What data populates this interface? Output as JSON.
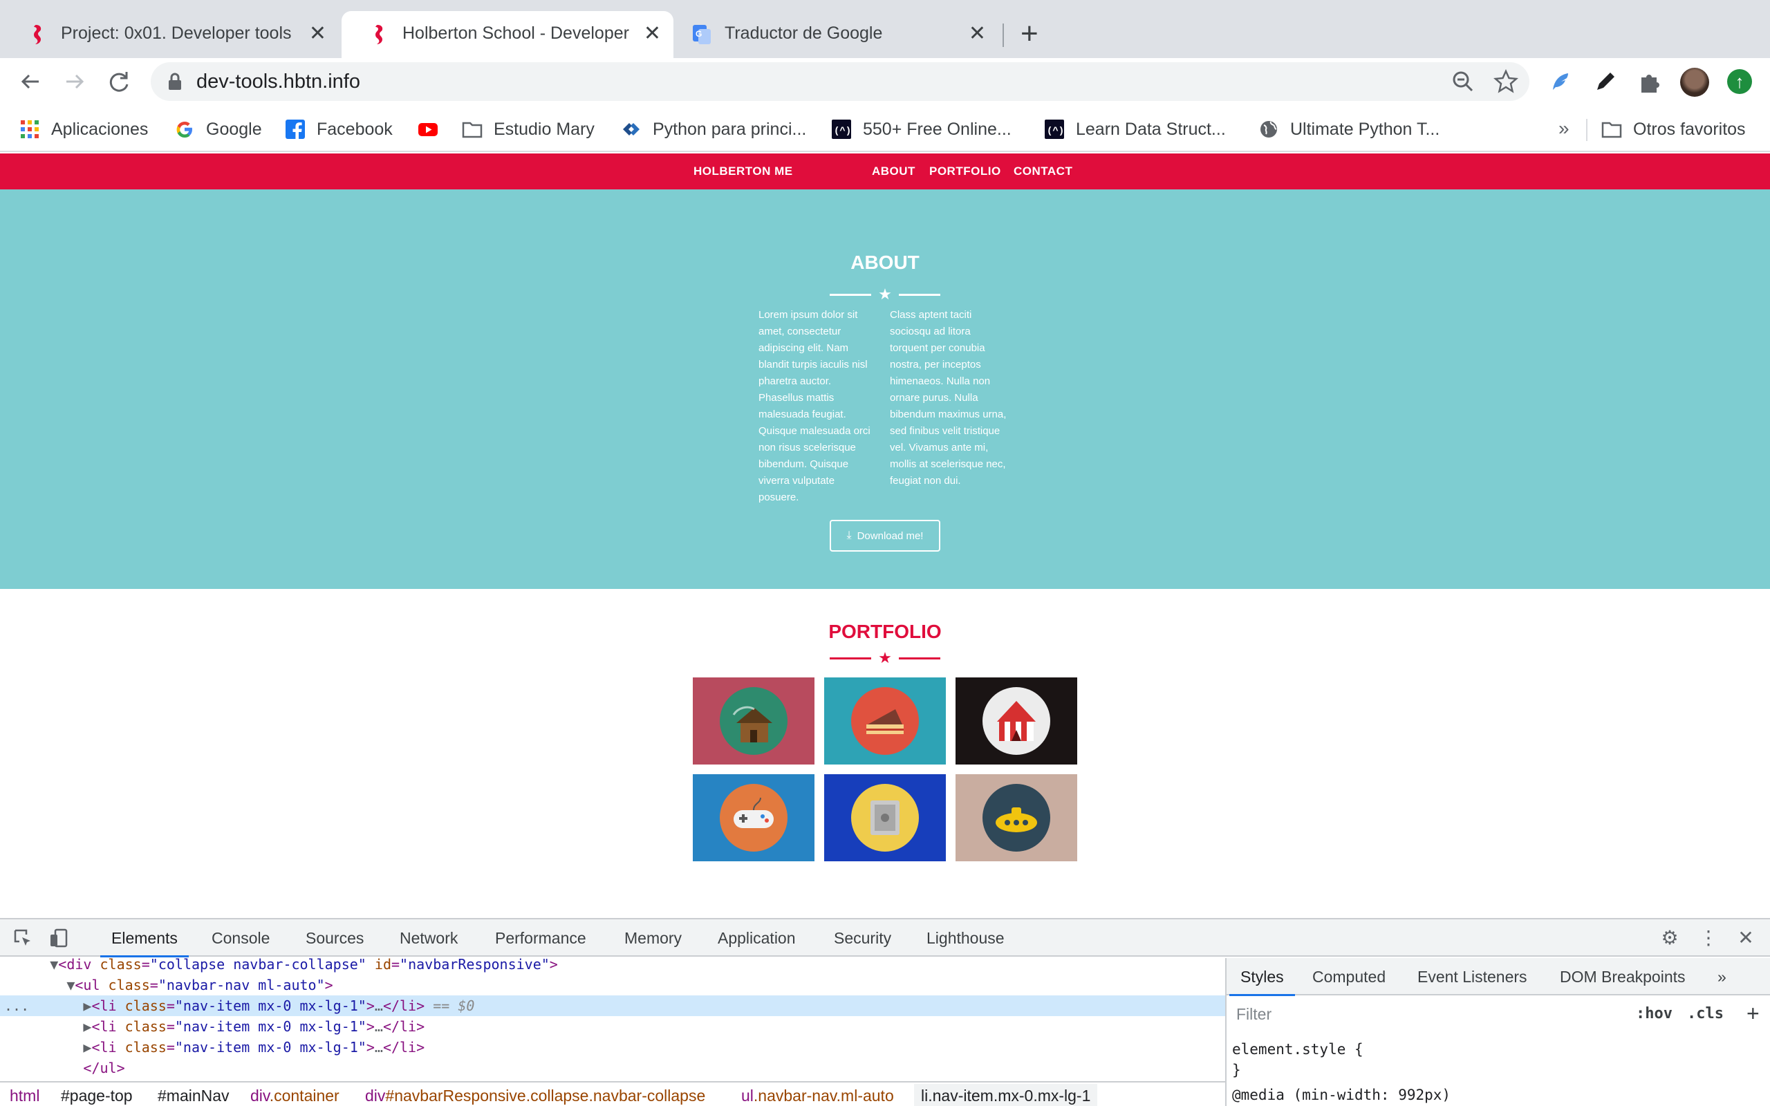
{
  "browser": {
    "tabs": [
      {
        "title": "Project: 0x01. Developer tools"
      },
      {
        "title": "Holberton School - Developer t"
      },
      {
        "title": "Traductor de Google"
      }
    ],
    "new_tab": "+",
    "close_glyph": "✕",
    "url": "dev-tools.hbtn.info"
  },
  "bookmarks": {
    "items": [
      {
        "label": "Aplicaciones",
        "icon": "apps-grid-icon"
      },
      {
        "label": "Google",
        "icon": "google-icon"
      },
      {
        "label": "Facebook",
        "icon": "facebook-icon"
      },
      {
        "label": "",
        "icon": "youtube-icon"
      },
      {
        "label": "Estudio Mary",
        "icon": "folder-icon"
      },
      {
        "label": "Python para princi...",
        "icon": "python-site-icon"
      },
      {
        "label": "550+ Free Online...",
        "icon": "freecodecamp-icon"
      },
      {
        "label": "Learn Data Struct...",
        "icon": "freecodecamp-icon"
      },
      {
        "label": "Ultimate Python T...",
        "icon": "globe-icon"
      }
    ],
    "more": "»",
    "other": "Otros favoritos"
  },
  "site": {
    "brand": "HOLBERTON ME",
    "nav": [
      "ABOUT",
      "PORTFOLIO",
      "CONTACT"
    ],
    "about": {
      "title": "ABOUT",
      "col1": "Lorem ipsum dolor sit amet, consectetur adipiscing elit. Nam blandit turpis iaculis nisl pharetra auctor. Phasellus mattis malesuada feugiat. Quisque malesuada orci non risus scelerisque bibendum. Quisque viverra vulputate posuere.",
      "col2": "Class aptent taciti sociosqu ad litora torquent per conubia nostra, per inceptos himenaeos. Nulla non ornare purus. Nulla bibendum maximus urna, sed finibus velit tristique vel. Vivamus ante mi, mollis at scelerisque nec, feugiat non dui.",
      "button": "Download me!"
    },
    "portfolio": {
      "title": "PORTFOLIO",
      "items": [
        {
          "name": "cabin",
          "bg": "#b84b5e",
          "disc": "#2e8b6e"
        },
        {
          "name": "cake",
          "bg": "#2ea3b5",
          "disc": "#e0523f"
        },
        {
          "name": "circus",
          "bg": "#1a1414",
          "disc": "#ececec"
        },
        {
          "name": "game",
          "bg": "#2784c3",
          "disc": "#e27a3f"
        },
        {
          "name": "safe",
          "bg": "#173ebb",
          "disc": "#efcc4c"
        },
        {
          "name": "submarine",
          "bg": "#c9ada0",
          "disc": "#2f4858"
        }
      ]
    },
    "colors": {
      "brand_red": "#e00d3c",
      "about_bg": "#7ecdd1"
    }
  },
  "devtools": {
    "tabs": [
      "Elements",
      "Console",
      "Sources",
      "Network",
      "Performance",
      "Memory",
      "Application",
      "Security",
      "Lighthouse"
    ],
    "code": {
      "l0_tag": "<div ",
      "l0_a1": "class",
      "l0_v1": "\"collapse navbar-collapse\"",
      "l0_a2": "id",
      "l0_v2": "\"navbarResponsive\"",
      "l0_end": ">",
      "l1_tag": "<ul ",
      "l1_a1": "class",
      "l1_v1": "\"navbar-nav ml-auto\"",
      "l1_end": ">",
      "li_tag": "<li ",
      "li_attr": "class",
      "li_val": "\"nav-item mx-0 mx-lg-1\"",
      "li_mid": ">",
      "li_ell": "…",
      "li_close": "</li>",
      "selected_marker": "== $0",
      "dots": "...",
      "ul_close": "</ul>"
    },
    "breadcrumbs": [
      {
        "tag": "html",
        "cls": ""
      },
      {
        "tag": "#page-top",
        "cls": ""
      },
      {
        "tag": "#mainNav",
        "cls": ""
      },
      {
        "tag": "div",
        "cls": ".container"
      },
      {
        "tag": "div",
        "cls": "#navbarResponsive.collapse.navbar-collapse"
      },
      {
        "tag": "ul",
        "cls": ".navbar-nav.ml-auto"
      },
      {
        "tag": "li",
        "cls": ".nav-item.mx-0.mx-lg-1"
      }
    ],
    "styles": {
      "tabs": [
        "Styles",
        "Computed",
        "Event Listeners",
        "DOM Breakpoints"
      ],
      "more": "»",
      "filter_placeholder": "Filter",
      "hov": ":hov",
      "cls": ".cls",
      "plus": "+",
      "rules": [
        "element.style {",
        "}",
        "@media (min-width: 992px)"
      ]
    }
  }
}
